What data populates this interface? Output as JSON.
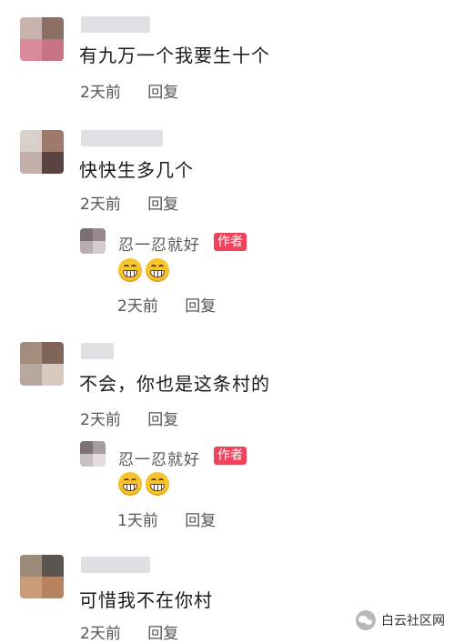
{
  "comments": [
    {
      "text": "有九万一个我要生十个",
      "time": "2天前",
      "reply": "回复",
      "avatar": [
        "#c8b3ad",
        "#8b6f66",
        "#d98a9a",
        "#c77585"
      ]
    },
    {
      "text": "快快生多几个",
      "time": "2天前",
      "reply": "回复",
      "avatar": [
        "#d9cfcb",
        "#9e7a6c",
        "#c4b0aa",
        "#5b4440"
      ],
      "replies": [
        {
          "name": "忍一忍就好",
          "badge": "作者",
          "time": "2天前",
          "reply": "回复",
          "avatar": [
            "#7b6f72",
            "#9a8a8d",
            "#b8aeb2",
            "#d4cdd0"
          ]
        }
      ]
    },
    {
      "text": "不会，你也是这条村的",
      "time": "2天前",
      "reply": "回复",
      "avatar": [
        "#a58d7e",
        "#7e6558",
        "#b7a79e",
        "#d8c9c0"
      ],
      "replies": [
        {
          "name": "忍一忍就好",
          "badge": "作者",
          "time": "1天前",
          "reply": "回复",
          "avatar": [
            "#7d7276",
            "#a89ca0",
            "#c9c0c3",
            "#e2dcdf"
          ]
        }
      ]
    },
    {
      "text": "可惜我不在你村",
      "time": "2天前",
      "reply": "回复",
      "avatar": [
        "#9c8a7b",
        "#5a5450",
        "#c99b76",
        "#b7825e"
      ]
    }
  ],
  "watermark": {
    "text": "白云社区网"
  },
  "colors": {
    "badge": "#f0425b",
    "meta_text": "#555555",
    "body_text": "#1a1a1a"
  }
}
